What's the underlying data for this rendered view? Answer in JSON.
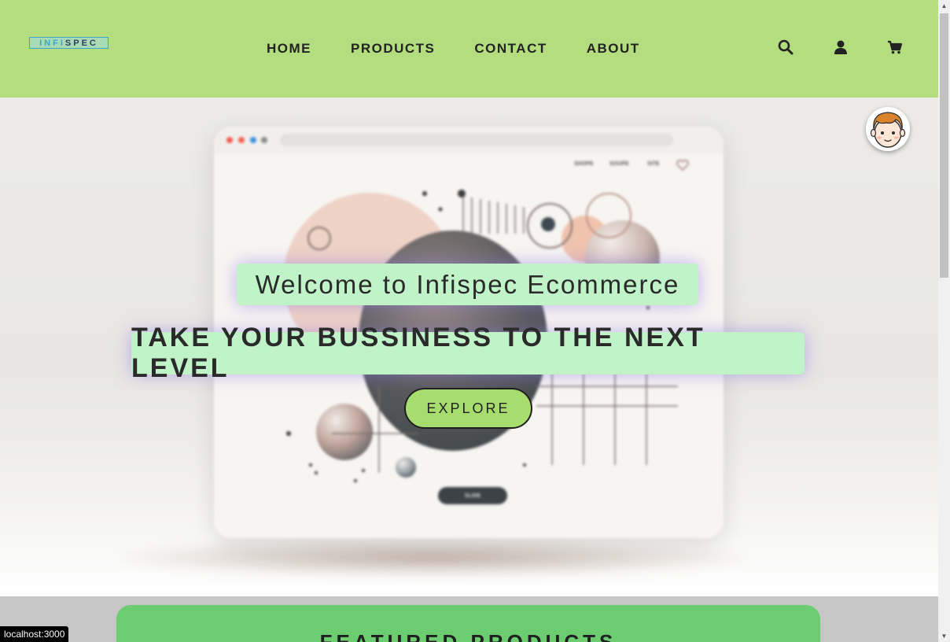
{
  "header": {
    "logo_text_left": "INFI",
    "logo_text_mid": "SPEC",
    "nav": [
      {
        "label": "HOME"
      },
      {
        "label": "PRODUCTS"
      },
      {
        "label": "CONTACT"
      },
      {
        "label": "ABOUT"
      }
    ],
    "icons": [
      "search-icon",
      "user-icon",
      "cart-icon"
    ]
  },
  "hero": {
    "welcome": "Welcome to Infispec Ecommerce",
    "tagline": "TAKE YOUR BUSSINESS TO THE NEXT LEVEL",
    "explore_label": "EXPLORE",
    "mock_nav": [
      "SHOPE",
      "SOUPE",
      "SITE"
    ],
    "mock_button": "SLIDE"
  },
  "featured": {
    "title": "FEATURED PRODUCTS"
  },
  "status_bar": {
    "url": "localhost:3000"
  },
  "colors": {
    "navbar": "#b3dd7e",
    "banner_bg": "#c0f3c8",
    "explore_bg": "#a7dd6e",
    "featured_bg": "#6ccd70"
  }
}
